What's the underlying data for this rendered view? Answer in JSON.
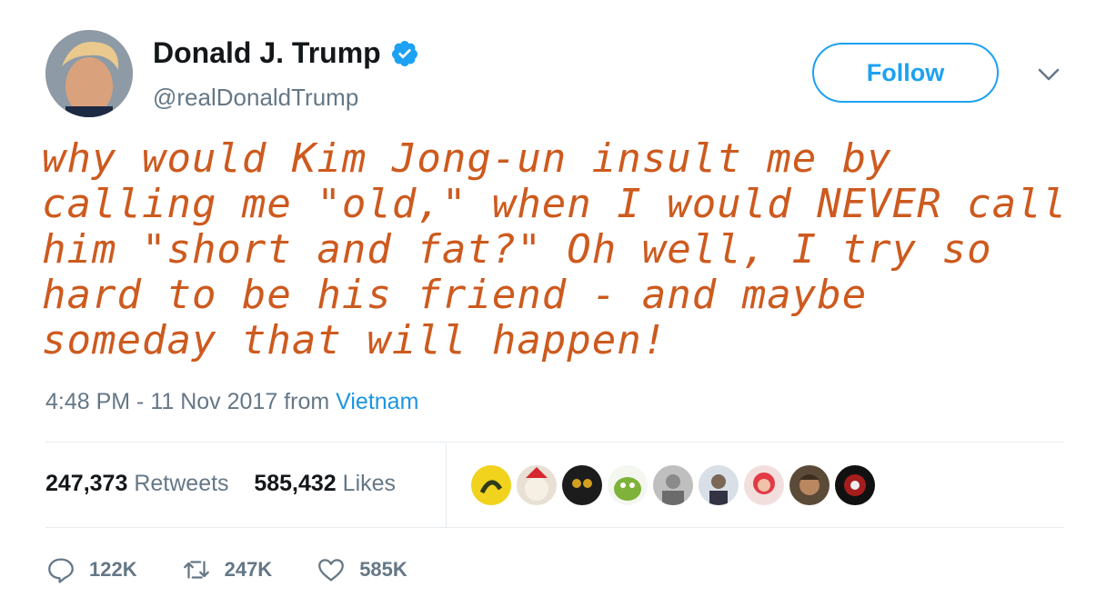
{
  "author": {
    "name": "Donald J. Trump",
    "handle": "@realDonaldTrump"
  },
  "follow_label": "Follow",
  "tweet_lines": [
    "why would Kim Jong-un insult me by",
    "calling me \"old,\" when I would NEVER call",
    "him \"short and fat?\" Oh well, I try so",
    "hard to be his friend - and maybe",
    "someday that will happen!"
  ],
  "meta": {
    "time": "4:48 PM - 11 Nov 2017 from ",
    "location": "Vietnam"
  },
  "stats": {
    "retweets_count": "247,373",
    "retweets_label": "Retweets",
    "likes_count": "585,432",
    "likes_label": "Likes"
  },
  "actions": {
    "replies": "122K",
    "retweets": "247K",
    "likes": "585K"
  },
  "colors": {
    "accent": "#1da1f2",
    "handwriting": "#cd5a1e",
    "secondary_text": "#657786"
  }
}
